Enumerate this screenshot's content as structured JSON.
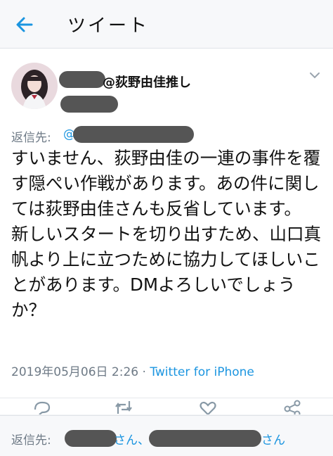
{
  "header": {
    "title": "ツイート",
    "back_icon": "arrow-left-icon"
  },
  "tweet": {
    "handle_suffix": "@荻野由佳推し",
    "reply_to_label": "返信先:",
    "reply_to_at": "@",
    "text": "すいません、荻野由佳の一連の事件を覆す隠ぺい作戦があります。あの件に関しては荻野由佳さんも反省しています。\n新しいスタートを切り出すため、山口真帆より上に立つために協力してほしいことがあります。DMよろしいでしょうか？",
    "timestamp": "2019年05月06日 2:26",
    "separator": " · ",
    "source": "Twitter for iPhone"
  },
  "actions": [
    "reply-icon",
    "retweet-icon",
    "like-icon",
    "share-icon"
  ],
  "reply_bar": {
    "label": "返信先:",
    "san1": "さん、",
    "san2": "さん"
  },
  "colors": {
    "accent": "#1b95e0",
    "muted": "#6e7a86",
    "redaction": "#555555"
  }
}
